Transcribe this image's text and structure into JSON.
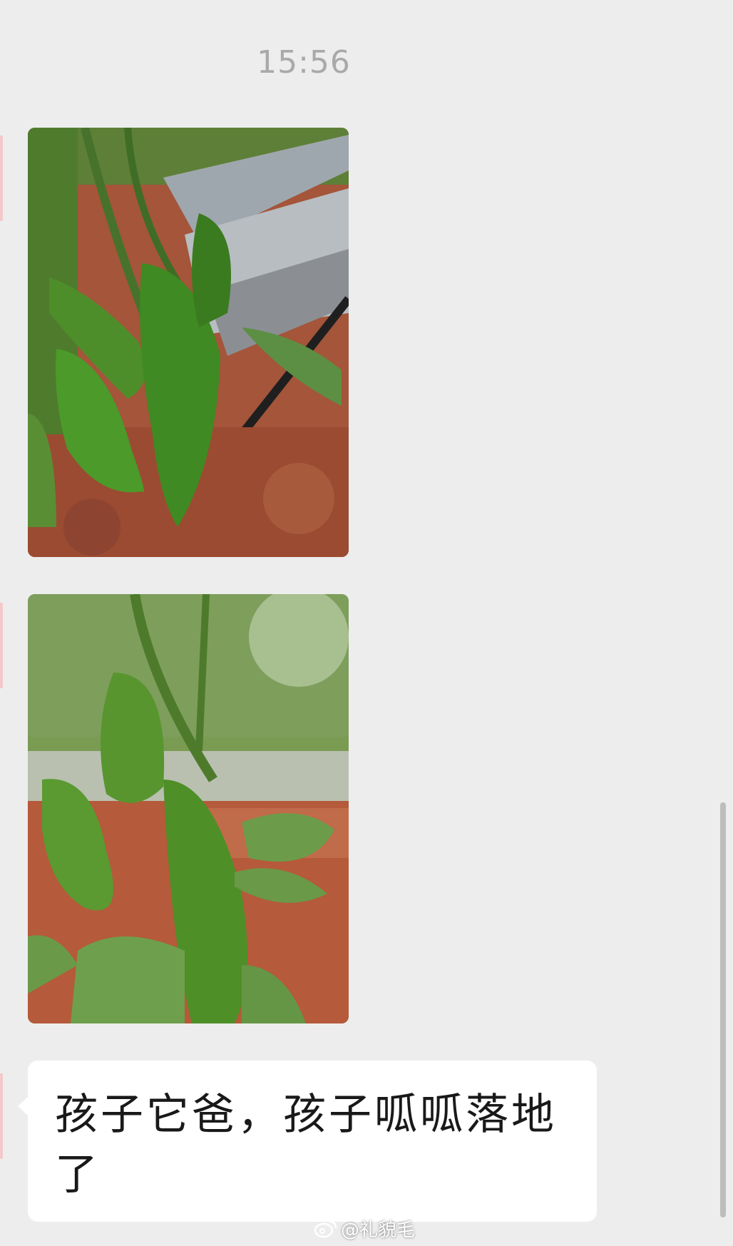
{
  "chat": {
    "timestamp": "15:56",
    "messages": [
      {
        "type": "image",
        "icon": "pepper-plant-photo-1"
      },
      {
        "type": "image",
        "icon": "pepper-plant-photo-2"
      },
      {
        "type": "text",
        "text": "孩子它爸，孩子呱呱落地了"
      }
    ]
  },
  "watermark": {
    "text": "@礼貌毛",
    "icon": "weibo-logo-icon"
  },
  "colors": {
    "background": "#ededed",
    "bubble": "#ffffff",
    "timestamp": "#a9a9a9"
  }
}
